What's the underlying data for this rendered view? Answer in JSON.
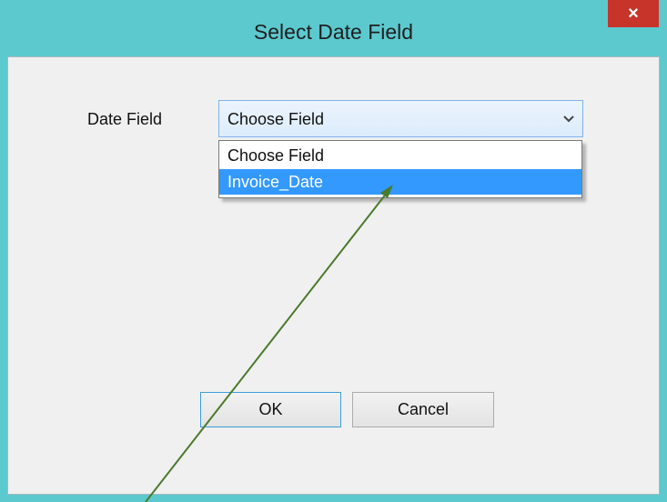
{
  "window": {
    "title": "Select Date Field",
    "close_glyph": "×"
  },
  "form": {
    "date_field_label": "Date Field",
    "selected_value": "Choose Field",
    "options": [
      "Choose Field",
      "Invoice_Date"
    ]
  },
  "buttons": {
    "ok_label": "OK",
    "cancel_label": "Cancel"
  },
  "colors": {
    "titlebar": "#5cc9cf",
    "close_button": "#c7352a",
    "highlight": "#3399ff",
    "annotation_arrow": "#4a7a2c"
  },
  "icons": {
    "close": "close-icon",
    "dropdown": "chevron-down-icon"
  }
}
